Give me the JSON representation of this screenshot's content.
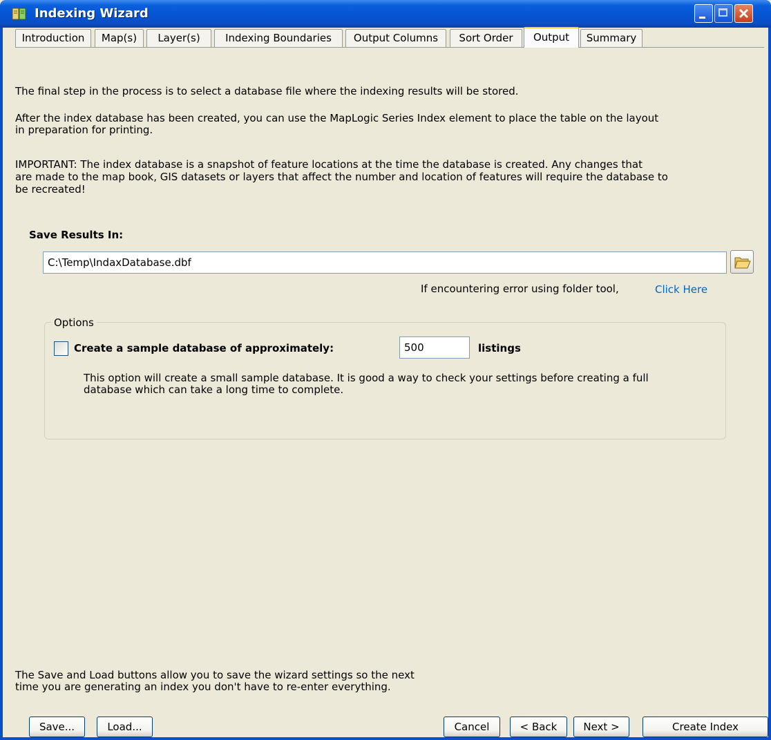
{
  "window": {
    "title": "Indexing Wizard"
  },
  "tabs": [
    {
      "label": "Introduction"
    },
    {
      "label": "Map(s)"
    },
    {
      "label": "Layer(s)"
    },
    {
      "label": "Indexing Boundaries"
    },
    {
      "label": "Output Columns"
    },
    {
      "label": "Sort Order"
    },
    {
      "label": "Output",
      "active": true
    },
    {
      "label": "Summary"
    }
  ],
  "content": {
    "intro_1": "The final step in the process is to select a database file where the indexing results will be stored.",
    "intro_2_line1": "After the index database has been created, you can use the MapLogic Series Index element to place the table on the layout",
    "intro_2_line2": "in preparation for printing.",
    "important_line1": "IMPORTANT:  The index database is a snapshot of feature locations at the time the database is created.  Any changes that",
    "important_line2": "are made to the map book, GIS datasets or layers that affect the number and location of features will require the database to",
    "important_line3": "be recreated!",
    "save_results_label": "Save Results In:",
    "save_path_value": "C:\\Temp\\IndaxDatabase.dbf",
    "folder_hint": "If encountering error using folder tool,",
    "click_here_link": "Click Here"
  },
  "options": {
    "group_label": "Options",
    "sample_checkbox_label": "Create a sample database of approximately:",
    "sample_checked": false,
    "sample_count_value": "500",
    "listings_label": "listings",
    "description_line1": "This option will create a small sample database.  It is good a way to check your settings before creating a full",
    "description_line2": "database which can take a long time to complete."
  },
  "footer": {
    "note_line1": "The Save and Load buttons allow you to save the wizard settings so the next",
    "note_line2": "time you are generating an index you don't have to re-enter everything.",
    "save_button": "Save...",
    "load_button": "Load...",
    "cancel_button": "Cancel",
    "back_button": "< Back",
    "next_button": "Next >",
    "create_button": "Create Index"
  },
  "colors": {
    "title_bar": "#0a5fdc",
    "dialog_bg": "#ece9d8",
    "active_tab_highlight": "#ffc83c",
    "link": "#0066cc"
  }
}
